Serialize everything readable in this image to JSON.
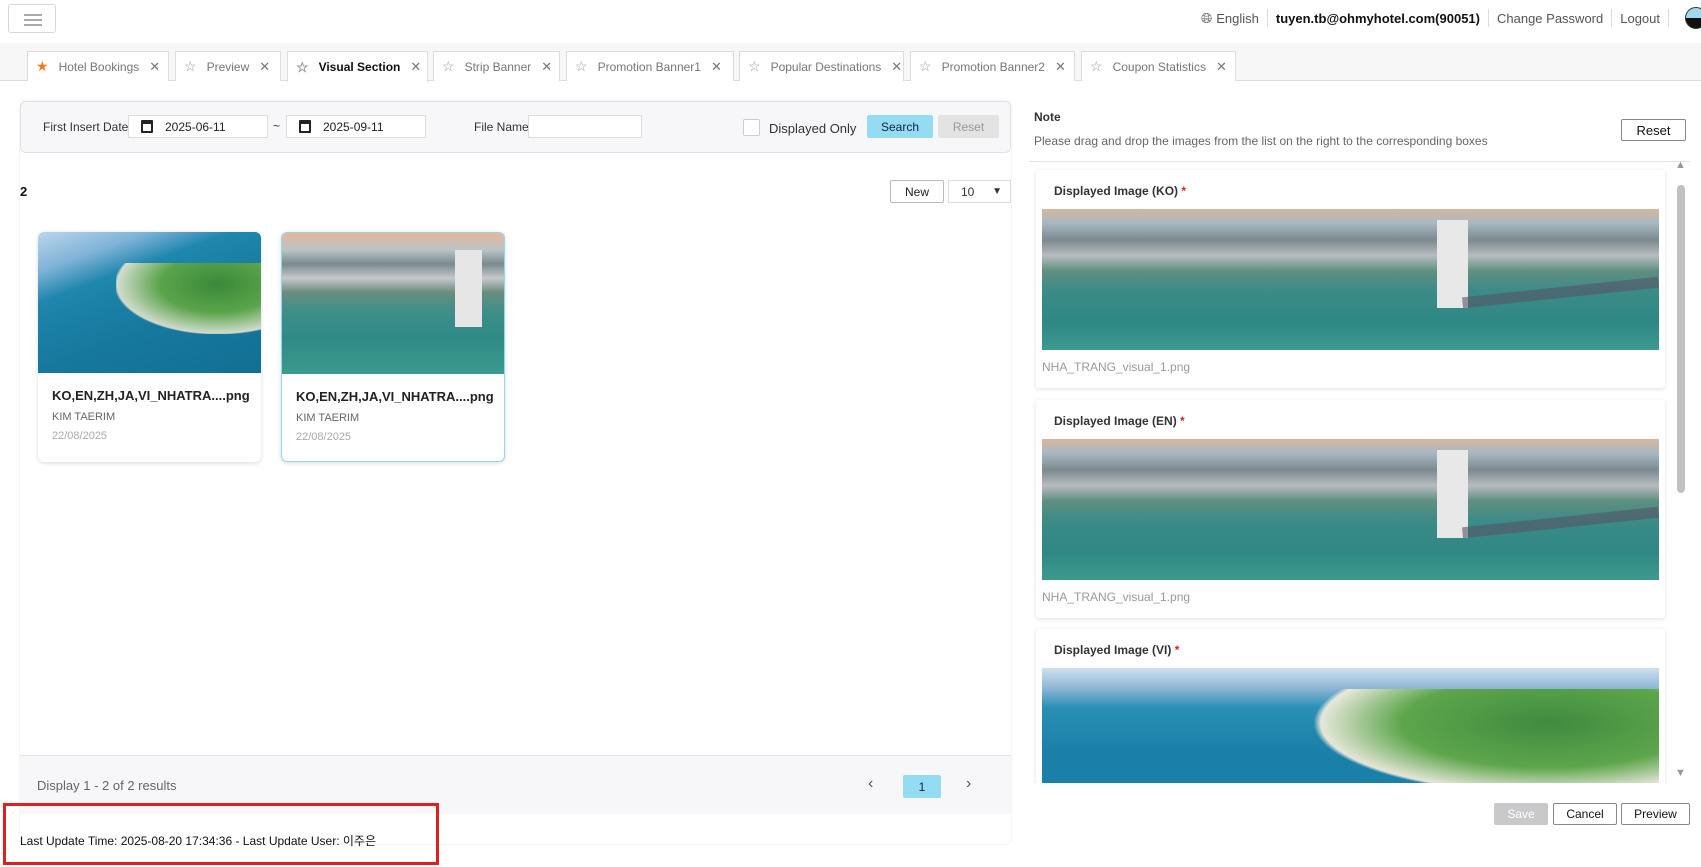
{
  "header": {
    "language": "English",
    "user": "tuyen.tb@ohmyhotel.com(90051)",
    "change_password": "Change Password",
    "logout": "Logout"
  },
  "tabs": [
    {
      "label": "Hotel Bookings",
      "favorite": true
    },
    {
      "label": "Preview"
    },
    {
      "label": "Visual Section",
      "active": true
    },
    {
      "label": "Strip Banner"
    },
    {
      "label": "Promotion Banner1"
    },
    {
      "label": "Popular Destinations"
    },
    {
      "label": "Promotion Banner2"
    },
    {
      "label": "Coupon Statistics"
    }
  ],
  "filter": {
    "date_label": "First Insert Date",
    "date_from": "2025-06-11",
    "tilde": "~",
    "date_to": "2025-09-11",
    "file_name_label": "File Name",
    "file_name_value": "",
    "displayed_only": "Displayed Only",
    "search": "Search",
    "reset": "Reset"
  },
  "list": {
    "count": "2",
    "new": "New",
    "page_size": "10",
    "items": [
      {
        "name": "KO,EN,ZH,JA,VI_NHATRA....png",
        "author": "KIM TAERIM",
        "date": "22/08/2025"
      },
      {
        "name": "KO,EN,ZH,JA,VI_NHATRA....png",
        "author": "KIM TAERIM",
        "date": "22/08/2025"
      }
    ],
    "summary": "Display 1 - 2 of 2 results",
    "current_page": "1"
  },
  "footer": {
    "last_update": "Last Update Time: 2025-08-20 17:34:36 - Last Update User: 이주은"
  },
  "note": {
    "title": "Note",
    "description": "Please drag and drop the images from the list on the right to the corresponding boxes",
    "reset": "Reset"
  },
  "slots": [
    {
      "label": "Displayed Image (KO)",
      "file": "NHA_TRANG_visual_1.png"
    },
    {
      "label": "Displayed Image (EN)",
      "file": "NHA_TRANG_visual_1.png"
    },
    {
      "label": "Displayed Image (VI)",
      "file": ""
    }
  ],
  "required_mark": "*",
  "actions": {
    "save": "Save",
    "cancel": "Cancel",
    "preview": "Preview"
  }
}
